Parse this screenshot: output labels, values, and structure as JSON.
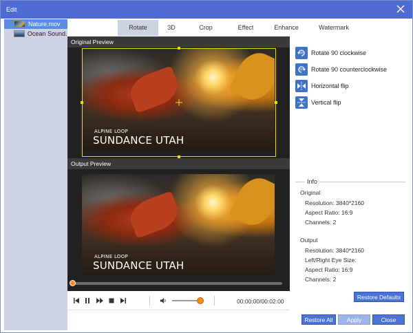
{
  "window": {
    "title": "Edit"
  },
  "files": [
    {
      "name": "Nature.mov",
      "selected": true
    },
    {
      "name": "Ocean Sound..."
    }
  ],
  "tabs": [
    {
      "label": "Rotate",
      "active": true
    },
    {
      "label": "3D"
    },
    {
      "label": "Crop"
    },
    {
      "label": "Effect"
    },
    {
      "label": "Enhance"
    },
    {
      "label": "Watermark"
    }
  ],
  "preview": {
    "original_label": "Original Preview",
    "output_label": "Output Preview",
    "overlay_small": "ALPINE LOOP",
    "overlay_big": "SUNDANCE UTAH"
  },
  "player": {
    "time": "00:00:00/00:02:00",
    "progress": 0.0,
    "volume": 0.85
  },
  "actions": [
    {
      "label": "Rotate 90 clockwise",
      "icon": "rotate-clockwise-icon"
    },
    {
      "label": "Rotate 90 counterclockwise",
      "icon": "rotate-counterclockwise-icon"
    },
    {
      "label": "Horizontal flip",
      "icon": "horizontal-flip-icon"
    },
    {
      "label": "Vertical flip",
      "icon": "vertical-flip-icon"
    }
  ],
  "info": {
    "title": "Info",
    "original_head": "Original",
    "original": [
      "Resolution: 3840*2160",
      "Aspect Ratio: 16:9",
      "Channels: 2"
    ],
    "output_head": "Output",
    "output": [
      "Resolution: 3840*2160",
      "Left/Right Eye Size:",
      "Aspect Ratio: 16:9",
      "Channels: 2"
    ]
  },
  "buttons": {
    "restore_defaults": "Restore Defaults",
    "restore_all": "Restore All",
    "apply": "Apply",
    "close": "Close"
  },
  "colors": {
    "accent": "#4e6ad3",
    "button": "#4a73d4",
    "crop_frame": "#e8e000",
    "knob": "#ff8a1a"
  }
}
